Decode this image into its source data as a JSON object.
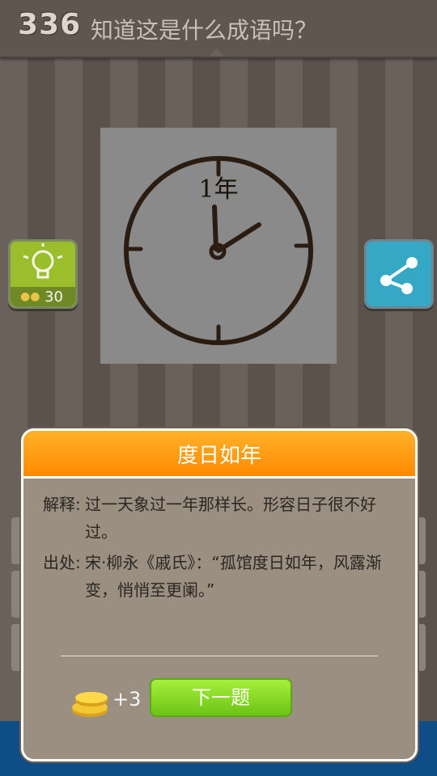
{
  "header": {
    "level": "336",
    "question": "知道这是什么成语吗？"
  },
  "puzzle": {
    "clock_label": "1年"
  },
  "hint": {
    "cost": "30"
  },
  "dialog": {
    "title": "度日如年",
    "explain_label": "解释:",
    "explain_text": "过一天象过一年那样长。形容日子很不好过。",
    "source_label": "出处:",
    "source_text": "宋·柳永《戚氏》：“孤馆度日如年，风露渐变，悄悄至更阑。”",
    "reward": "+3",
    "next_label": "下一题"
  },
  "colors": {
    "header_orange": "#ff9a10",
    "next_green": "#8ad82a",
    "share_blue": "#34a8c5",
    "hint_green": "#9bbf2c"
  }
}
